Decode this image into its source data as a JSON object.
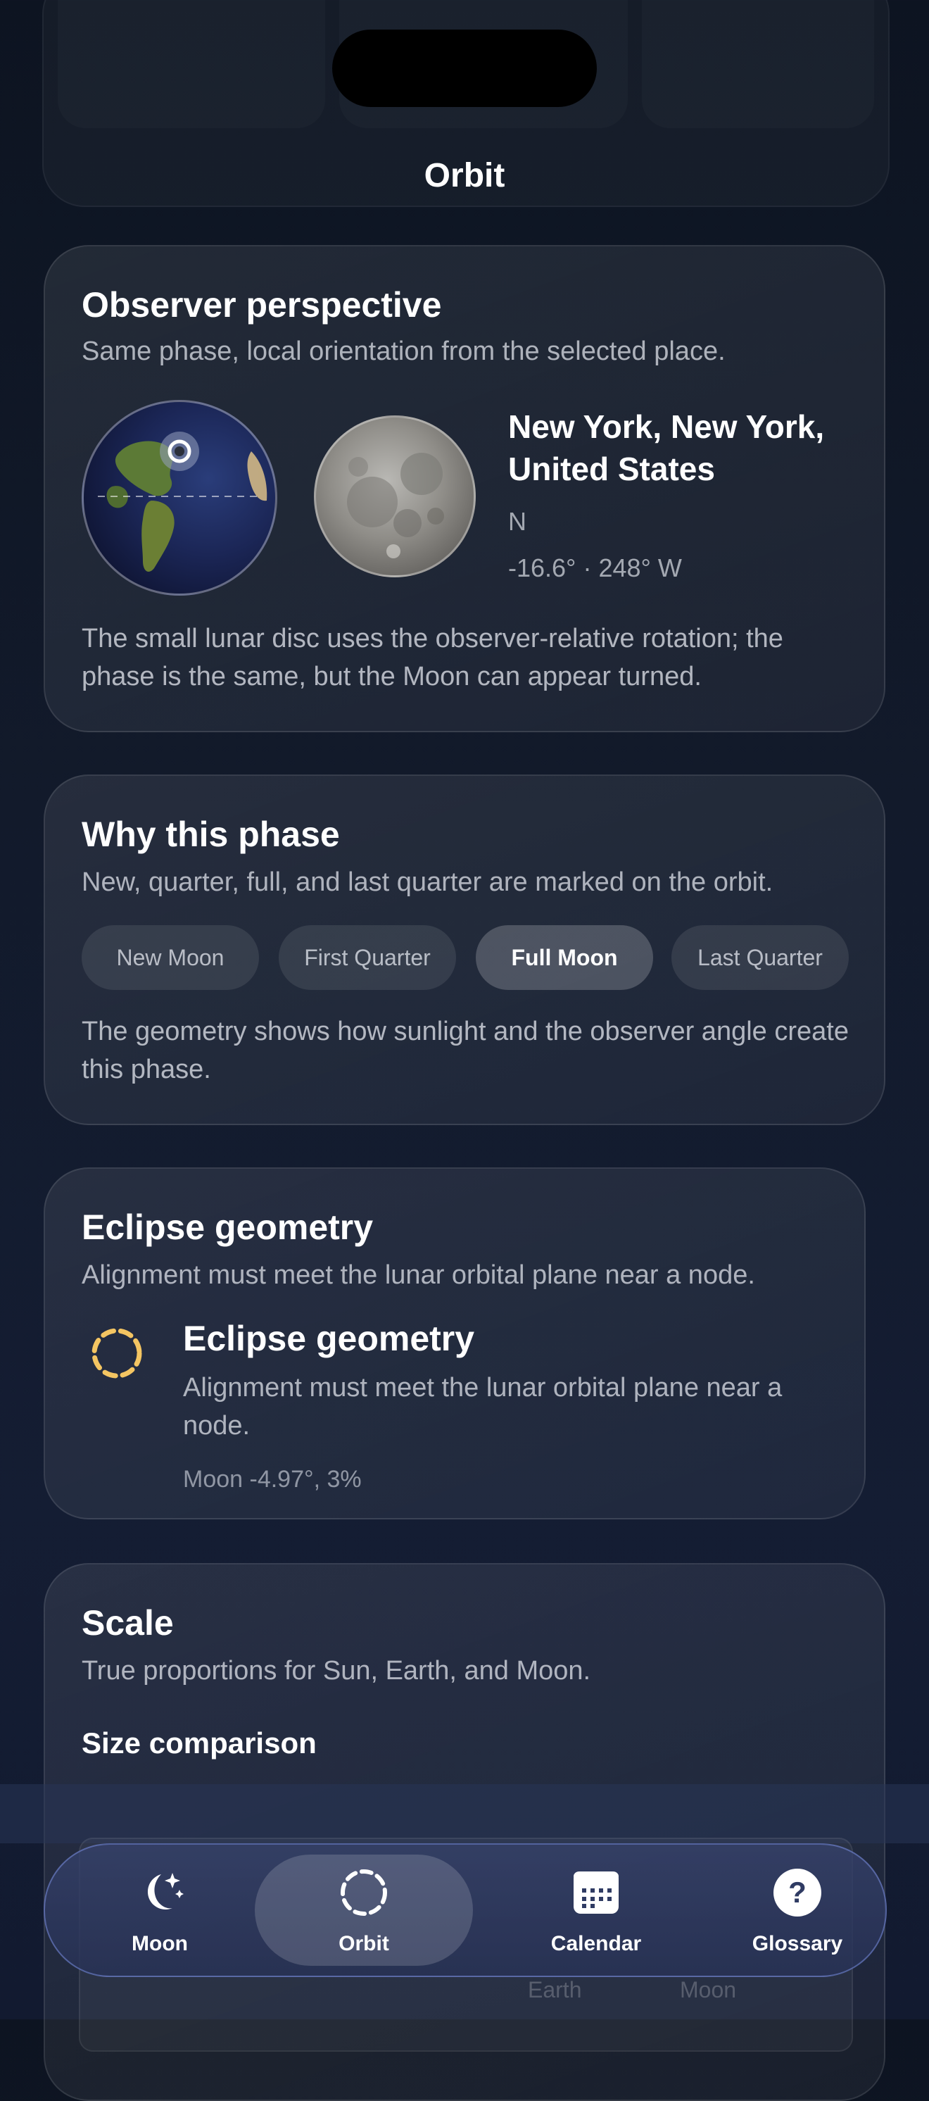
{
  "nav": {
    "title": "Orbit"
  },
  "observer": {
    "title": "Observer perspective",
    "subtitle": "Same phase, local orientation from the selected place.",
    "location": "New York, New York, United States",
    "direction": "N",
    "coordinates": "-16.6° · 248° W",
    "note": "The small lunar disc uses the observer-relative rotation; the phase is the same, but the Moon can appear turned."
  },
  "phase": {
    "title": "Why this phase",
    "subtitle": "New, quarter, full, and last quarter are marked on the orbit.",
    "chips": [
      {
        "label": "New Moon",
        "active": false
      },
      {
        "label": "First Quarter",
        "active": false
      },
      {
        "label": "Full Moon",
        "active": true
      },
      {
        "label": "Last Quarter",
        "active": false
      }
    ],
    "note": "The geometry shows how sunlight and the observer angle create this phase."
  },
  "eclipse": {
    "title": "Eclipse geometry",
    "subtitle": "Alignment must meet the lunar orbital plane near a node.",
    "item_title": "Eclipse geometry",
    "item_subtitle": "Alignment must meet the lunar orbital plane near a node.",
    "item_meta": "Moon -4.97°, 3%",
    "icon": "dashed-circle-icon",
    "icon_color": "#f4c562"
  },
  "scale": {
    "title": "Scale",
    "subtitle": "True proportions for Sun, Earth, and Moon.",
    "section": "Size comparison"
  },
  "tabbar": {
    "items": [
      {
        "label": "Moon",
        "icon": "moon-stars-icon",
        "active": false
      },
      {
        "label": "Orbit",
        "icon": "dashed-circle-icon",
        "active": true
      },
      {
        "label": "Calendar",
        "icon": "calendar-icon",
        "active": false
      },
      {
        "label": "Glossary",
        "icon": "question-icon",
        "active": false
      }
    ]
  },
  "background_labels": {
    "earth": "Earth",
    "moon": "Moon"
  },
  "colors": {
    "background": "#121a2b",
    "accent_eclipse": "#f4c562",
    "tabbar_border": "#7890dc"
  }
}
